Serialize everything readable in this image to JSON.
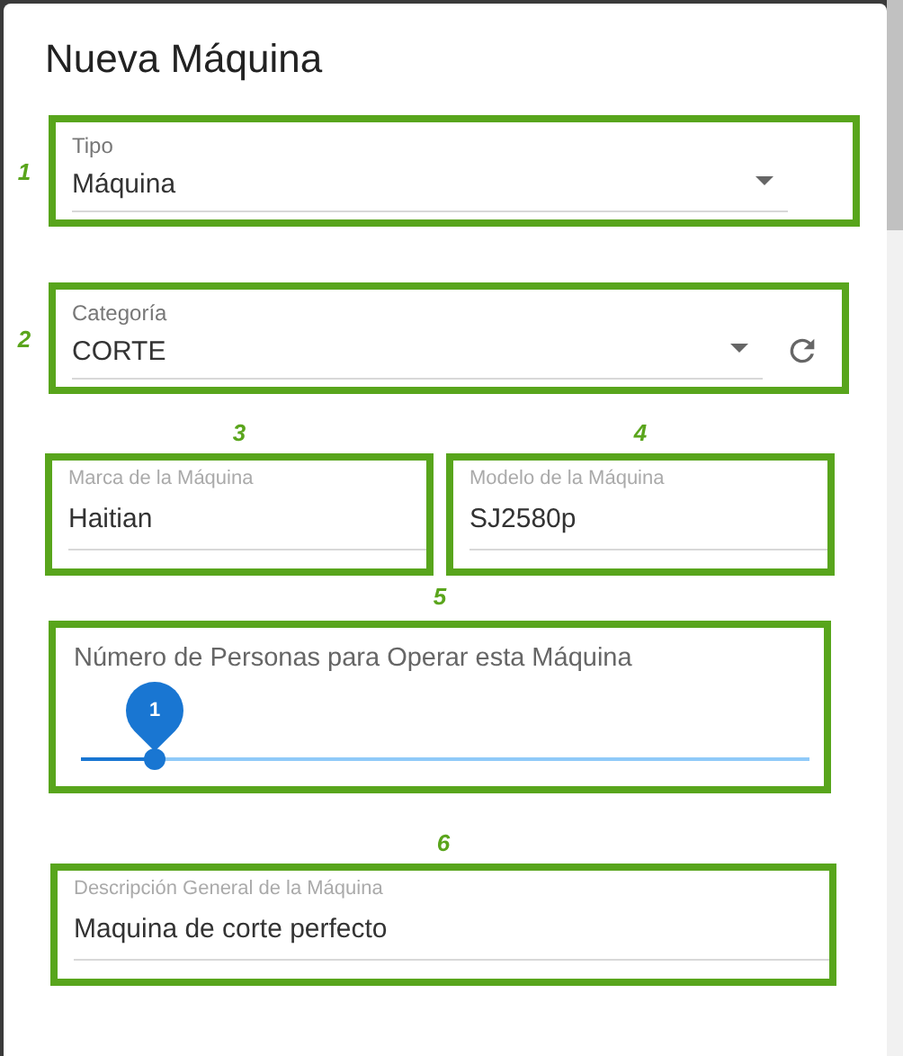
{
  "dialog": {
    "title": "Nueva Máquina"
  },
  "rows": [
    {
      "fields": [
        {
          "kind": "select",
          "callout": "1",
          "label": "Tipo",
          "value": "Máquina",
          "refresh": false
        }
      ]
    },
    {
      "fields": [
        {
          "kind": "select",
          "callout": "2",
          "label": "Categoría",
          "value": "CORTE",
          "refresh": true
        }
      ]
    },
    {
      "fields": [
        {
          "kind": "text",
          "callout": "3",
          "label": "Marca de la Máquina",
          "value": "Haitian"
        },
        {
          "kind": "text",
          "callout": "4",
          "label": "Modelo de la Máquina",
          "value": "SJ2580p"
        }
      ]
    },
    {
      "fields": [
        {
          "kind": "slider",
          "callout": "5",
          "label": "Número de Personas para Operar esta Máquina",
          "value": "1",
          "level": 0.1
        }
      ]
    },
    {
      "fields": [
        {
          "kind": "text",
          "callout": "6",
          "label": "Descripción General de la Máquina",
          "value": "Maquina de corte perfecto"
        }
      ]
    }
  ]
}
